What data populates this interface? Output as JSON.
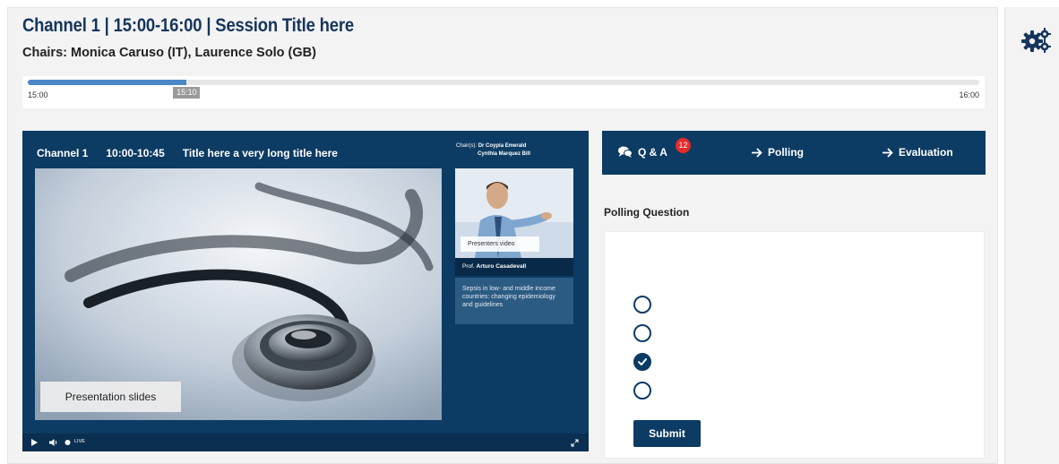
{
  "session": {
    "title": "Channel 1 | 15:00-16:00 | Session Title here",
    "chairs": "Chairs: Monica Caruso (IT), Laurence Solo (GB)"
  },
  "timeline": {
    "start": "15:00",
    "end": "16:00",
    "current": "15:10",
    "progress": 0.167
  },
  "player": {
    "channel": "Channel 1",
    "time": "10:00-10:45",
    "talk_title": "Title here a very long title here",
    "chairs_label": "Chair(s):",
    "chair_1": "Dr Coypia Emerald",
    "chair_2": "Cynthia Marquez Bill",
    "slides_label": "Presentation slides",
    "presenter_video_label": "Presenters video",
    "presenter_prefix": "Prof.",
    "presenter_name": "Arturo Casadevall",
    "presentation_topic": "Sepsis in low- and middle income countries: changing epidemiology and guidelines",
    "live_label": "LIVE"
  },
  "tabs": {
    "qa": {
      "label": "Q & A",
      "badge": "12",
      "icon": "chat-bubbles-icon"
    },
    "polling": {
      "label": "Polling",
      "icon": "arrow-right-icon"
    },
    "evaluation": {
      "label": "Evaluation",
      "icon": "arrow-right-icon"
    }
  },
  "poll": {
    "question": "Polling Question",
    "options": [
      {
        "selected": false
      },
      {
        "selected": false
      },
      {
        "selected": true
      },
      {
        "selected": false
      }
    ],
    "submit_label": "Submit"
  },
  "sidebar": {
    "icon": "gears-icon"
  },
  "colors": {
    "navy": "#0c3b63",
    "title": "#16355c",
    "progress": "#4a86c8",
    "badge": "#e52b2b"
  }
}
